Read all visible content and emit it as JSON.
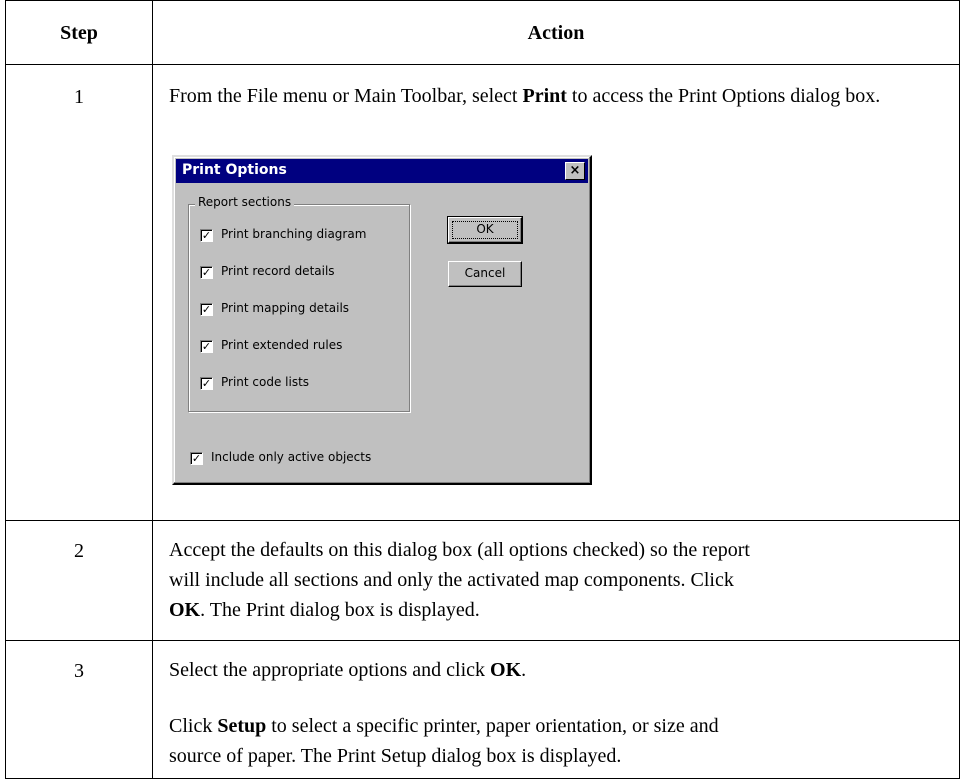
{
  "header": {
    "step": "Step",
    "action": "Action"
  },
  "rows": [
    {
      "step": "1",
      "text_pre": "From the File menu or Main Toolbar, select ",
      "text_bold": "Print",
      "text_post": " to access the Print Options dialog box."
    },
    {
      "step": "2",
      "line1": "Accept the defaults on this dialog box (all options checked) so the report",
      "line2": "will include all sections and only the activated map components. Click",
      "bold": "OK",
      "line3_post": ". The Print dialog box is displayed."
    },
    {
      "step": "3",
      "p1_pre": "Select the appropriate options and click ",
      "p1_bold": "OK",
      "p1_post": ".",
      "p2_pre": "Click ",
      "p2_bold": "Setup",
      "p2_post": " to select a specific printer, paper orientation, or size and",
      "p2_line2": "source of paper. The Print Setup dialog box is displayed."
    }
  ],
  "dialog": {
    "title": "Print Options",
    "close_glyph": "×",
    "group_label": "Report sections",
    "checkboxes": [
      {
        "label": "Print branching diagram",
        "checked": true
      },
      {
        "label": "Print record details",
        "checked": true
      },
      {
        "label": "Print mapping details",
        "checked": true
      },
      {
        "label": "Print extended rules",
        "checked": true
      },
      {
        "label": "Print code lists",
        "checked": true
      }
    ],
    "active_only": {
      "label": "Include only active objects",
      "checked": true
    },
    "check_glyph": "✓",
    "ok_label": "OK",
    "cancel_label": "Cancel"
  }
}
